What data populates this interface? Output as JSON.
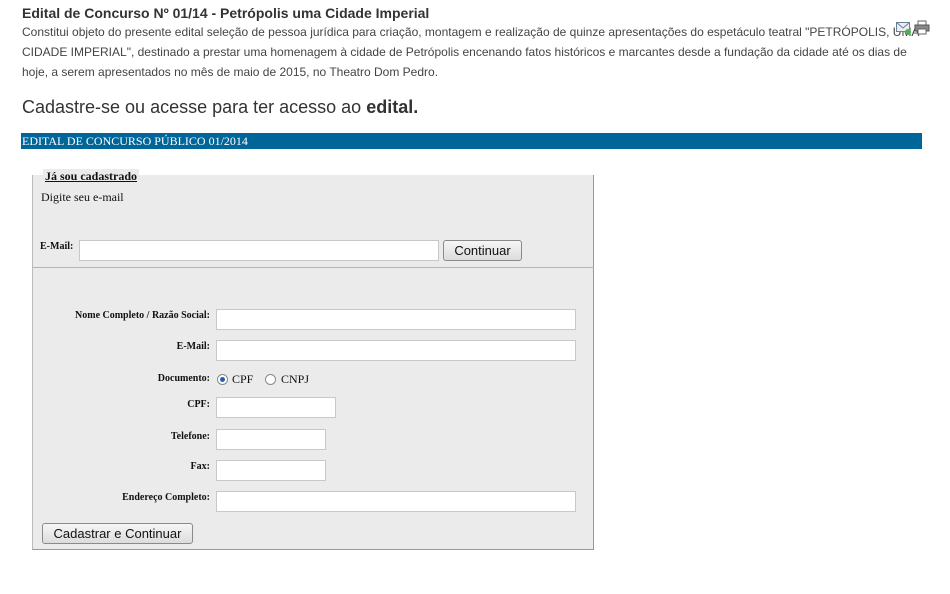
{
  "page": {
    "title": "Edital de Concurso Nº 01/14 - Petrópolis uma Cidade Imperial",
    "description": "Constitui objeto do presente edital seleção de pessoa jurídica para criação, montagem e realização de quinze apresentações do espetáculo teatral \"PETRÓPOLIS, UMA CIDADE IMPERIAL\", destinado a prestar uma homenagem à cidade de Petrópolis encenando fatos históricos e marcantes desde a fundação da cidade até os dias de hoje, a serem apresentados no mês de maio de 2015, no Theatro Dom Pedro.",
    "cadastre_prefix": "Cadastre-se ou acesse para ter acesso ao ",
    "cadastre_strong": "edital.",
    "bar_label": "EDITAL DE CONCURSO PÚBLICO 01/2014",
    "icons": [
      "email-icon",
      "print-icon"
    ]
  },
  "login": {
    "legend": "Já sou cadastrado",
    "hint": "Digite seu e-mail",
    "email_label": "E-Mail:",
    "email_value": "",
    "continue_label": "Continuar"
  },
  "register": {
    "name_label": "Nome Completo / Razão Social:",
    "email_label": "E-Mail:",
    "document_label": "Documento:",
    "doc_options": [
      "CPF",
      "CNPJ"
    ],
    "doc_selected": "CPF",
    "cpf_label": "CPF:",
    "phone_label": "Telefone:",
    "fax_label": "Fax:",
    "address_label": "Endereço Completo:",
    "submit_label": "Cadastrar e Continuar"
  }
}
